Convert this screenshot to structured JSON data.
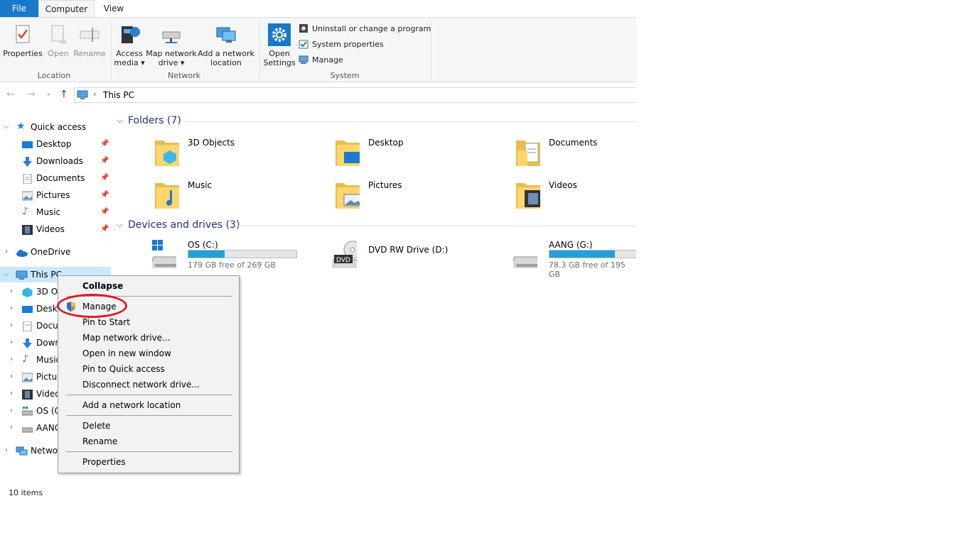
{
  "ribbon": {
    "tabs": [
      "File",
      "Computer",
      "View"
    ],
    "location": {
      "label": "Location",
      "properties": "Properties",
      "open": "Open",
      "rename": "Rename"
    },
    "network": {
      "label": "Network",
      "access_media_1": "Access",
      "access_media_2": "media ▾",
      "map_drive_1": "Map network",
      "map_drive_2": "drive ▾",
      "add_location_1": "Add a network",
      "add_location_2": "location"
    },
    "system": {
      "label": "System",
      "open_settings_1": "Open",
      "open_settings_2": "Settings",
      "uninstall": "Uninstall or change a program",
      "system_properties": "System properties",
      "manage": "Manage"
    }
  },
  "address": {
    "path": "This PC"
  },
  "nav": {
    "quick_access": "Quick access",
    "quick_items": [
      "Desktop",
      "Downloads",
      "Documents",
      "Pictures",
      "Music",
      "Videos"
    ],
    "onedrive": "OneDrive",
    "this_pc": "This PC",
    "this_pc_children": [
      "3D Ob",
      "Deskt",
      "Docu",
      "Down",
      "Music",
      "Pictur",
      "Video",
      "OS (C",
      "AANG"
    ],
    "network": "Networ"
  },
  "content": {
    "folders_header": "Folders (7)",
    "folders": [
      "3D Objects",
      "Desktop",
      "Documents",
      "Music",
      "Pictures",
      "Videos"
    ],
    "devices_header": "Devices and drives (3)",
    "drives": [
      {
        "name": "OS (C:)",
        "free": "179 GB free of 269 GB",
        "used_fraction": 0.335
      },
      {
        "name": "DVD RW Drive (D:)"
      },
      {
        "name": "AANG (G:)",
        "free": "78.3 GB free of 195 GB",
        "used_fraction": 0.6
      }
    ]
  },
  "status": {
    "items": "10 items"
  },
  "context_menu": {
    "items": [
      "Collapse",
      "Manage",
      "Pin to Start",
      "Map network drive...",
      "Open in new window",
      "Pin to Quick access",
      "Disconnect network drive...",
      "Add a network location",
      "Delete",
      "Rename",
      "Properties"
    ]
  },
  "colors": {
    "accent": "#1979ca",
    "drive_fill": "#26a0da",
    "highlight_ring": "#d81c24",
    "selection": "#cce8ff"
  }
}
